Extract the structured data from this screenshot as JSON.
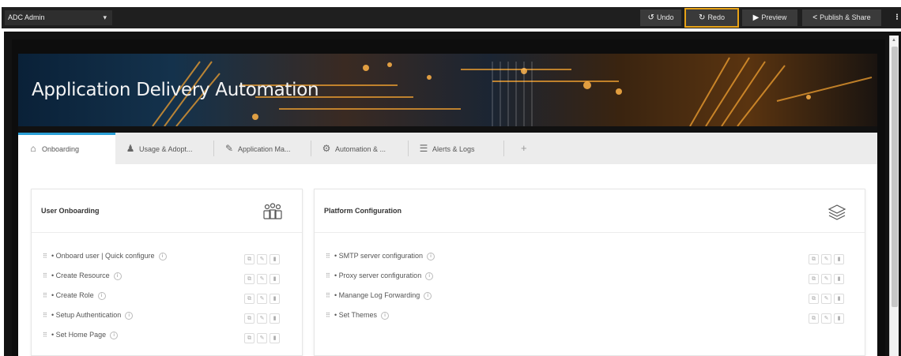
{
  "toolbar": {
    "app_select": "ADC Admin",
    "undo_label": "Undo",
    "redo_label": "Redo",
    "preview_label": "Preview",
    "publish_label": "Publish & Share",
    "more_label": "⁝"
  },
  "banner": {
    "title": "Application Delivery Automation"
  },
  "tabs": [
    {
      "label": "Onboarding",
      "icon": "home-icon"
    },
    {
      "label": "Usage & Adopt...",
      "icon": "users-icon"
    },
    {
      "label": "Application Ma...",
      "icon": "edit-document-icon"
    },
    {
      "label": "Automation & ...",
      "icon": "gear-box-icon"
    },
    {
      "label": "Alerts & Logs",
      "icon": "log-icon"
    }
  ],
  "add_tab_label": "+",
  "user_onboarding": {
    "title": "User Onboarding",
    "icon": "people-group-icon",
    "items": [
      "• Onboard user | Quick configure",
      "• Create Resource",
      "• Create Role",
      "• Setup Authentication",
      "• Set Home Page"
    ]
  },
  "platform_configuration": {
    "title": "Platform Configuration",
    "icon": "layers-icon",
    "items": [
      "• SMTP server configuration",
      "• Proxy server configuration",
      "• Manange Log Forwarding",
      "• Set Themes"
    ]
  },
  "colors": {
    "accent": "#2a9fd6",
    "focus_outline": "#e8a317",
    "topbar": "#1f1f1f"
  }
}
